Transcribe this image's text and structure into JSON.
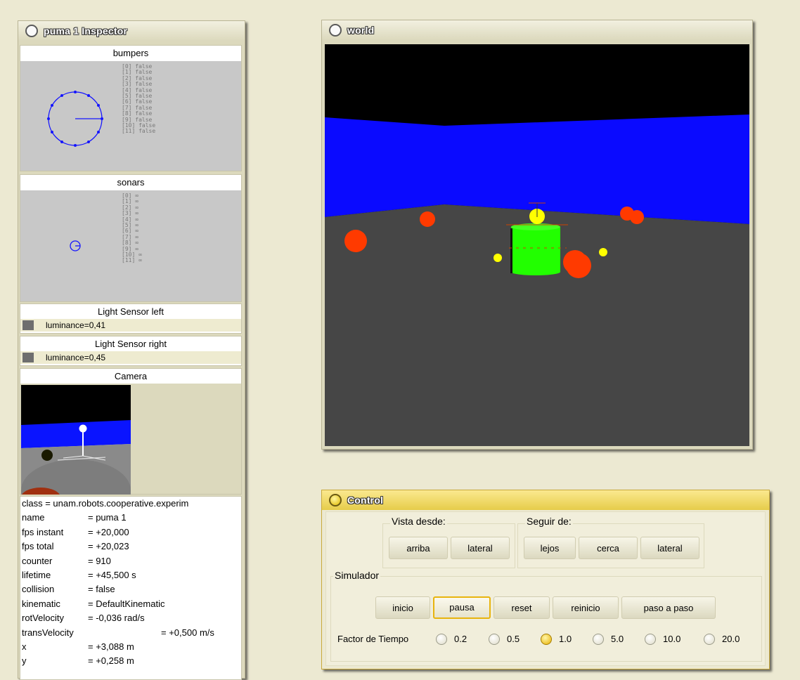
{
  "inspector": {
    "title": "puma 1 Inspector",
    "bumpers": {
      "title": "bumpers",
      "values": [
        "[0] false",
        "[1] false",
        "[2] false",
        "[3] false",
        "[4] false",
        "[5] false",
        "[6] false",
        "[7] false",
        "[8] false",
        "[9] false",
        "[10] false",
        "[11] false"
      ]
    },
    "sonars": {
      "title": "sonars",
      "values": [
        "[0] ∞",
        "[1] ∞",
        "[2] ∞",
        "[3] ∞",
        "[4] ∞",
        "[5] ∞",
        "[6] ∞",
        "[7] ∞",
        "[8] ∞",
        "[9] ∞",
        "[10] ∞",
        "[11] ∞"
      ]
    },
    "light_left": {
      "title": "Light Sensor left",
      "value": "luminance=0,41"
    },
    "light_right": {
      "title": "Light Sensor right",
      "value": "luminance=0,45"
    },
    "camera": {
      "title": "Camera"
    },
    "info": {
      "class_line": "class = unam.robots.cooperative.experim",
      "rows": [
        {
          "k": "name",
          "v": "= puma 1"
        },
        {
          "k": "fps instant",
          "v": "= +20,000"
        },
        {
          "k": "fps total",
          "v": "= +20,023"
        },
        {
          "k": "counter",
          "v": "= 910"
        },
        {
          "k": "lifetime",
          "v": "= +45,500 s"
        },
        {
          "k": "collision",
          "v": "= false"
        },
        {
          "k": "kinematic",
          "v": "= DefaultKinematic"
        },
        {
          "k": "rotVelocity",
          "v": "= -0,036 rad/s"
        }
      ],
      "trans": {
        "k": "transVelocity",
        "v": "= +0,500 m/s"
      },
      "x": {
        "k": "x",
        "v": "= +3,088 m"
      },
      "y": {
        "k": "y",
        "v": "= +0,258 m"
      }
    }
  },
  "world": {
    "title": "world"
  },
  "control": {
    "title": "Control",
    "vista": {
      "label": "Vista desde:",
      "buttons": [
        "arriba",
        "lateral"
      ]
    },
    "seguir": {
      "label": "Seguir de:",
      "buttons": [
        "lejos",
        "cerca",
        "lateral"
      ]
    },
    "simulador": {
      "label": "Simulador",
      "buttons": [
        "inicio",
        "pausa",
        "reset",
        "reinicio",
        "paso a paso"
      ],
      "selected": "pausa"
    },
    "factor": {
      "label": "Factor de Tiempo",
      "options": [
        "0.2",
        "0.5",
        "1.0",
        "5.0",
        "10.0",
        "20.0"
      ],
      "selected": "1.0"
    }
  },
  "colors": {
    "sky": "#000000",
    "wall": "#0000ff",
    "floor": "#464646",
    "robot": "#00ff00",
    "ball_red": "#ff3300",
    "ball_yellow": "#ffff00",
    "control_accent": "#e6cd4a"
  }
}
